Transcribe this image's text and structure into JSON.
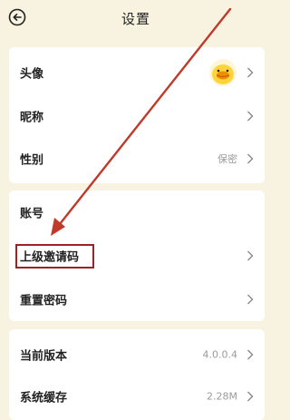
{
  "header": {
    "title": "设置",
    "back_icon": "back-arrow-icon"
  },
  "profile_section": {
    "items": [
      {
        "label": "头像",
        "value": "",
        "icon": "avatar-duck-icon"
      },
      {
        "label": "昵称",
        "value": ""
      },
      {
        "label": "性别",
        "value": "保密"
      }
    ]
  },
  "account_section": {
    "items": [
      {
        "label": "账号",
        "value": ""
      },
      {
        "label": "上级邀请码",
        "value": ""
      },
      {
        "label": "重置密码",
        "value": ""
      }
    ]
  },
  "info_section": {
    "items": [
      {
        "label": "当前版本",
        "value": "4.0.0.4"
      },
      {
        "label": "系统缓存",
        "value": "2.28M"
      }
    ]
  },
  "colors": {
    "background": "#f7f3e0",
    "card": "#ffffff",
    "annotation": "#9b2226",
    "avatar_yellow": "#ffd43b"
  }
}
